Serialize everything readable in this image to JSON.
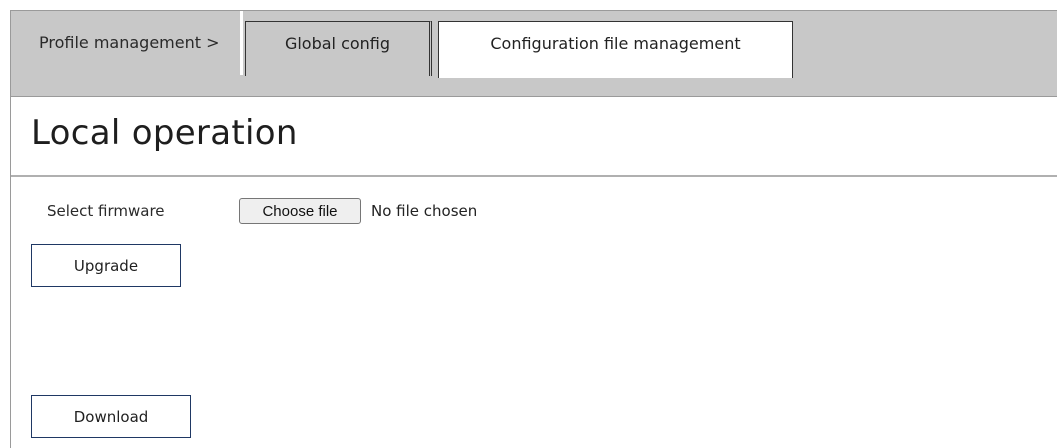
{
  "tabs": {
    "breadcrumb": "Profile management >",
    "global_config": "Global config",
    "config_file_management": "Configuration file management"
  },
  "page": {
    "title": "Local operation"
  },
  "firmware": {
    "label": "Select firmware",
    "choose_button": "Choose file",
    "status": "No file chosen"
  },
  "actions": {
    "upgrade": "Upgrade",
    "download": "Download"
  },
  "colors": {
    "tab_bar": "#c8c8c8",
    "active_tab": "#ffffff",
    "button_border": "#1f3864"
  }
}
